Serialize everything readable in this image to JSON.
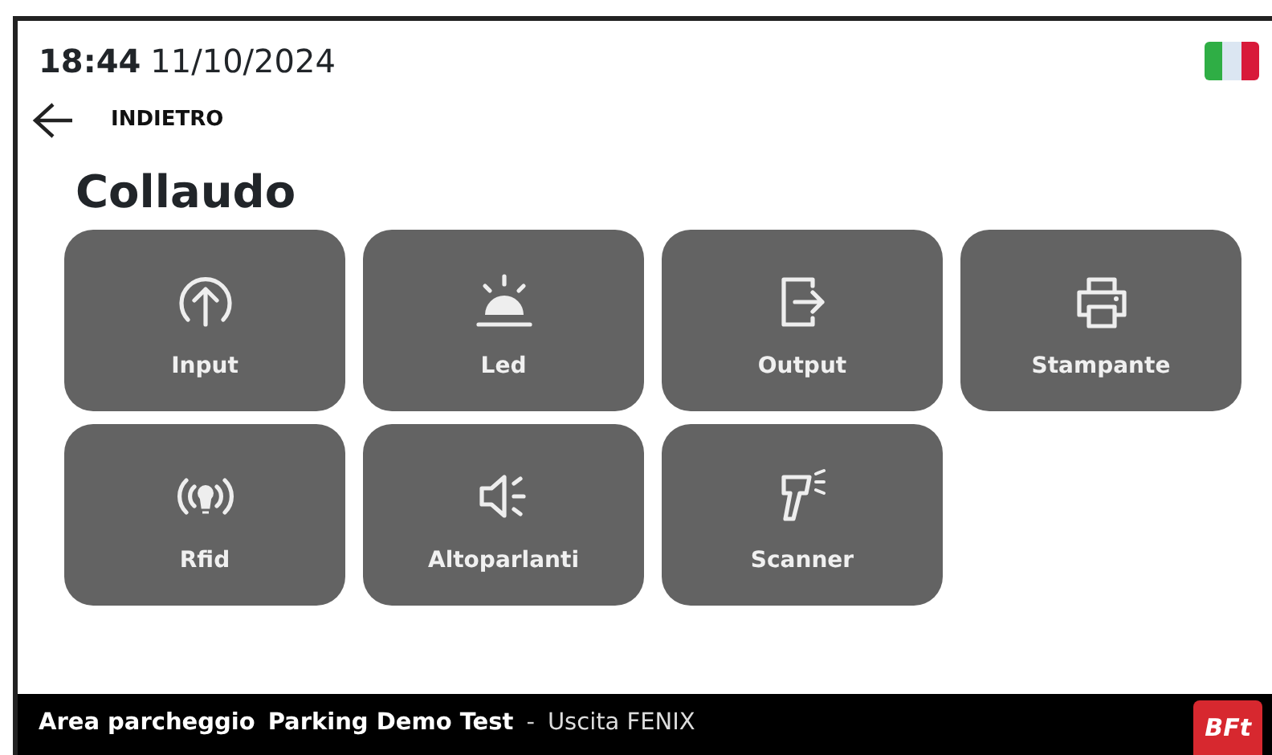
{
  "header": {
    "time": "18:44",
    "date": "11/10/2024",
    "language_flag": {
      "kind": "italy"
    }
  },
  "back": {
    "label": "INDIETRO"
  },
  "title": "Collaudo",
  "tiles": [
    {
      "label": "Input",
      "kind": "input"
    },
    {
      "label": "Led",
      "kind": "led"
    },
    {
      "label": "Output",
      "kind": "output"
    },
    {
      "label": "Stampante",
      "kind": "printer"
    },
    {
      "label": "Rfid",
      "kind": "rfid"
    },
    {
      "label": "Altoparlanti",
      "kind": "speaker"
    },
    {
      "label": "Scanner",
      "kind": "scanner"
    }
  ],
  "footer": {
    "area_label": "Area parcheggio",
    "area_name": "Parking Demo Test",
    "separator": "-",
    "exit": "Uscita FENIX",
    "logo": "BFt"
  }
}
